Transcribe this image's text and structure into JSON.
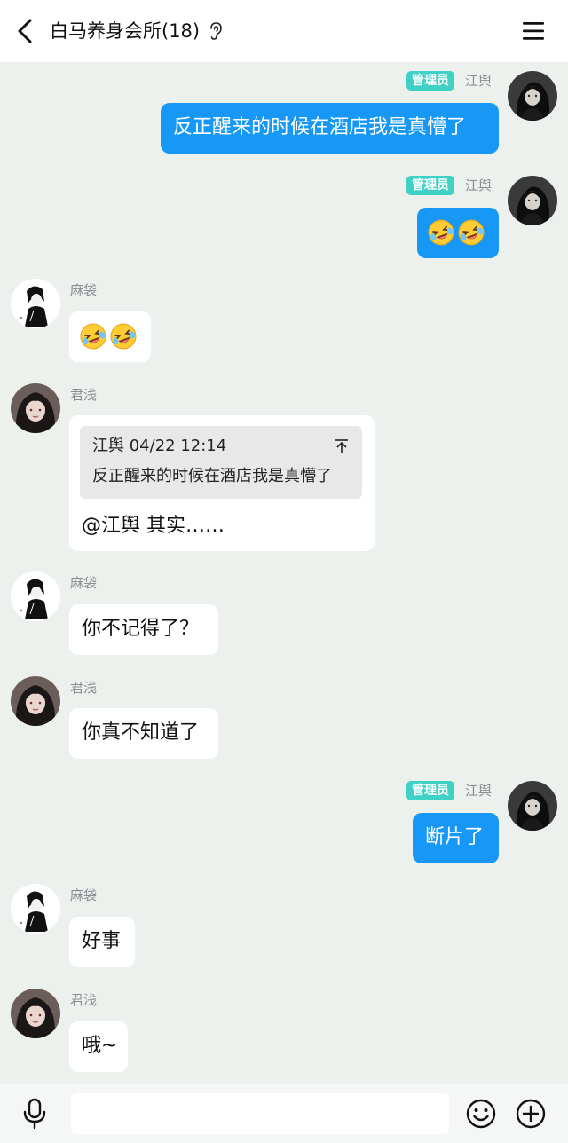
{
  "header": {
    "title": "白马养身会所(18)",
    "back_icon": "back-arrow-icon",
    "ear_icon": "ear-icon",
    "menu_icon": "hamburger-menu-icon"
  },
  "messages": [
    {
      "sender": "江舆",
      "badge": "管理员",
      "direction": "out",
      "text": "反正醒来的时候在酒店我是真懵了"
    },
    {
      "sender": "江舆",
      "badge": "管理员",
      "direction": "out",
      "emoji": "laughing-crying-face-icon x2"
    },
    {
      "sender": "麻袋",
      "direction": "in",
      "emoji": "laughing-crying-face-icon x2"
    },
    {
      "sender": "君浅",
      "direction": "in",
      "quote": {
        "author": "江舆",
        "time": "04/22 12:14",
        "text": "反正醒来的时候在酒店我是真懵了"
      },
      "text": "@江舆 其实……"
    },
    {
      "sender": "麻袋",
      "direction": "in",
      "text": "你不记得了？"
    },
    {
      "sender": "君浅",
      "direction": "in",
      "text": "你真不知道了"
    },
    {
      "sender": "江舆",
      "badge": "管理员",
      "direction": "out",
      "text": "断片了"
    },
    {
      "sender": "麻袋",
      "direction": "in",
      "text": "好事"
    },
    {
      "sender": "君浅",
      "direction": "in",
      "text": "哦~"
    }
  ],
  "input_bar": {
    "placeholder": "",
    "mic_icon": "microphone-icon",
    "emoji_icon": "smiley-icon",
    "plus_icon": "plus-circle-icon"
  },
  "colors": {
    "background": "#edf1ee",
    "outgoing_bubble": "#1798f6",
    "incoming_bubble": "#ffffff",
    "admin_badge": "#3fd0c6"
  }
}
